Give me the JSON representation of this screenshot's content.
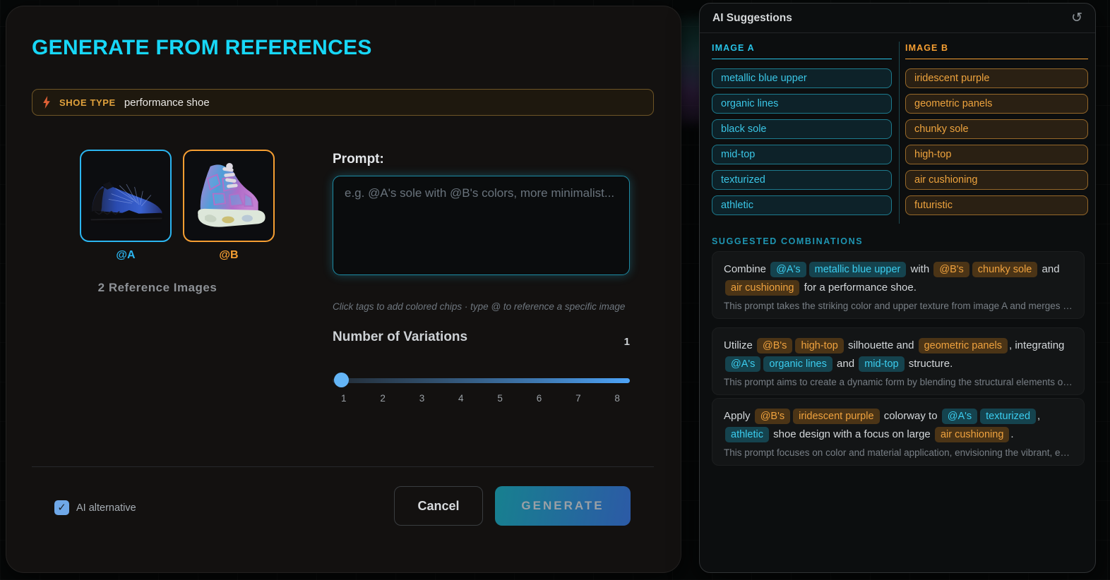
{
  "modal": {
    "title": "GENERATE FROM REFERENCES",
    "shoe_type": {
      "label": "SHOE TYPE",
      "value": "performance shoe"
    },
    "references": {
      "image_a_label": "@A",
      "image_b_label": "@B",
      "count_text": "2 Reference Images"
    },
    "prompt": {
      "label": "Prompt:",
      "placeholder": "e.g. @A's sole with @B's colors, more minimalist...",
      "hint": "Click tags to add colored chips · type @ to reference a specific image"
    },
    "variations": {
      "label": "Number of Variations",
      "value": "1",
      "ticks": [
        "1",
        "2",
        "3",
        "4",
        "5",
        "6",
        "7",
        "8"
      ]
    },
    "footer": {
      "checkbox_label": "AI alternative",
      "checkbox_checked": true,
      "cancel_label": "Cancel",
      "generate_label": "GENERATE"
    }
  },
  "suggestions": {
    "title": "AI Suggestions",
    "image_a": {
      "header": "IMAGE A",
      "tags": [
        "metallic blue upper",
        "organic lines",
        "black sole",
        "mid-top",
        "texturized",
        "athletic"
      ]
    },
    "image_b": {
      "header": "IMAGE B",
      "tags": [
        "iridescent purple",
        "geometric panels",
        "chunky sole",
        "high-top",
        "air cushioning",
        "futuristic"
      ]
    },
    "combinations_header": "SUGGESTED COMBINATIONS",
    "cards": [
      {
        "segments": [
          {
            "type": "text",
            "text": "Combine "
          },
          {
            "type": "chip-a",
            "text": "@A's"
          },
          {
            "type": "chip-a",
            "text": "metallic blue upper"
          },
          {
            "type": "text",
            "text": " with "
          },
          {
            "type": "chip-b",
            "text": "@B's"
          },
          {
            "type": "chip-b",
            "text": "chunky sole"
          },
          {
            "type": "text",
            "text": " and "
          },
          {
            "type": "chip-b",
            "text": "air cushioning"
          },
          {
            "type": "text",
            "text": " for a performance shoe."
          }
        ],
        "description": "This prompt takes the striking color and upper texture from image A and merges it wi…"
      },
      {
        "segments": [
          {
            "type": "text",
            "text": "Utilize "
          },
          {
            "type": "chip-b",
            "text": "@B's"
          },
          {
            "type": "chip-b",
            "text": "high-top"
          },
          {
            "type": "text",
            "text": " silhouette and "
          },
          {
            "type": "chip-b",
            "text": "geometric panels"
          },
          {
            "type": "text",
            "text": ", integrating "
          },
          {
            "type": "chip-a",
            "text": "@A's"
          },
          {
            "type": "chip-a",
            "text": "organic lines"
          },
          {
            "type": "text",
            "text": " and "
          },
          {
            "type": "chip-a",
            "text": "mid-top"
          },
          {
            "type": "text",
            "text": " structure."
          }
        ],
        "description": "This prompt aims to create a dynamic form by blending the structural elements of bot…"
      },
      {
        "segments": [
          {
            "type": "text",
            "text": "Apply "
          },
          {
            "type": "chip-b",
            "text": "@B's"
          },
          {
            "type": "chip-b",
            "text": "iridescent purple"
          },
          {
            "type": "text",
            "text": " colorway to "
          },
          {
            "type": "chip-a",
            "text": "@A's"
          },
          {
            "type": "chip-a",
            "text": "texturized"
          },
          {
            "type": "text",
            "text": ", "
          },
          {
            "type": "chip-a",
            "text": "athletic"
          },
          {
            "type": "text",
            "text": " shoe design with a focus on large "
          },
          {
            "type": "chip-b",
            "text": "air cushioning"
          },
          {
            "type": "text",
            "text": "."
          }
        ],
        "description": "This prompt focuses on color and material application, envisioning the vibrant, eye-…"
      }
    ]
  },
  "colors": {
    "accent_cyan": "#17d7f7",
    "accent_orange": "#f59e32",
    "accent_amber": "#e0a13c",
    "generate_gradient_start": "#17808f",
    "generate_gradient_end": "#2c5aa6",
    "slider_thumb": "#64b5f6",
    "checkbox": "#6fa8e8"
  }
}
